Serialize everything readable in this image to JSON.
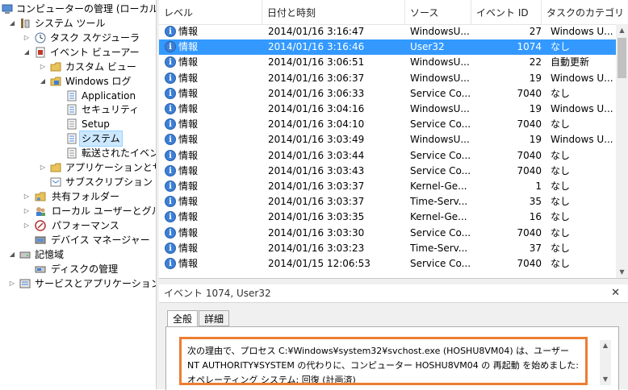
{
  "tree": {
    "root": "コンピューターの管理 (ローカル)",
    "system_tools": "システム ツール",
    "task_scheduler": "タスク スケジューラ",
    "event_viewer": "イベント ビューアー",
    "custom_views": "カスタム ビュー",
    "windows_logs": "Windows ログ",
    "application": "Application",
    "security": "セキュリティ",
    "setup": "Setup",
    "system": "システム",
    "forwarded": "転送されたイベント",
    "apps_services": "アプリケーションとサービ",
    "subscriptions": "サブスクリプション",
    "shared_folders": "共有フォルダー",
    "local_users": "ローカル ユーザーとグループ",
    "performance": "パフォーマンス",
    "device_manager": "デバイス マネージャー",
    "storage": "記憶域",
    "disk_mgmt": "ディスクの管理",
    "services_apps": "サービスとアプリケーション"
  },
  "list": {
    "columns": [
      "レベル",
      "日付と時刻",
      "ソース",
      "イベント ID",
      "タスクのカテゴリ"
    ],
    "rows": [
      {
        "level": "情報",
        "date": "2014/01/16 3:16:47",
        "source": "WindowsU...",
        "id": "27",
        "cat": "Windows U..."
      },
      {
        "level": "情報",
        "date": "2014/01/16 3:16:46",
        "source": "User32",
        "id": "1074",
        "cat": "なし"
      },
      {
        "level": "情報",
        "date": "2014/01/16 3:06:51",
        "source": "WindowsU...",
        "id": "22",
        "cat": "自動更新"
      },
      {
        "level": "情報",
        "date": "2014/01/16 3:06:37",
        "source": "WindowsU...",
        "id": "19",
        "cat": "Windows U..."
      },
      {
        "level": "情報",
        "date": "2014/01/16 3:06:33",
        "source": "Service Co...",
        "id": "7040",
        "cat": "なし"
      },
      {
        "level": "情報",
        "date": "2014/01/16 3:04:16",
        "source": "WindowsU...",
        "id": "19",
        "cat": "Windows U..."
      },
      {
        "level": "情報",
        "date": "2014/01/16 3:04:10",
        "source": "Service Co...",
        "id": "7040",
        "cat": "なし"
      },
      {
        "level": "情報",
        "date": "2014/01/16 3:03:49",
        "source": "WindowsU...",
        "id": "19",
        "cat": "Windows U..."
      },
      {
        "level": "情報",
        "date": "2014/01/16 3:03:44",
        "source": "Service Co...",
        "id": "7040",
        "cat": "なし"
      },
      {
        "level": "情報",
        "date": "2014/01/16 3:03:43",
        "source": "Service Co...",
        "id": "7040",
        "cat": "なし"
      },
      {
        "level": "情報",
        "date": "2014/01/16 3:03:37",
        "source": "Kernel-Ge...",
        "id": "1",
        "cat": "なし"
      },
      {
        "level": "情報",
        "date": "2014/01/16 3:03:37",
        "source": "Time-Serv...",
        "id": "35",
        "cat": "なし"
      },
      {
        "level": "情報",
        "date": "2014/01/16 3:03:35",
        "source": "Kernel-Ge...",
        "id": "16",
        "cat": "なし"
      },
      {
        "level": "情報",
        "date": "2014/01/16 3:03:30",
        "source": "Service Co...",
        "id": "7040",
        "cat": "なし"
      },
      {
        "level": "情報",
        "date": "2014/01/16 3:03:23",
        "source": "Time-Serv...",
        "id": "37",
        "cat": "なし"
      },
      {
        "level": "情報",
        "date": "2014/01/15 12:06:53",
        "source": "Service Co...",
        "id": "7040",
        "cat": "なし"
      }
    ],
    "selected_index": 1
  },
  "details": {
    "title": "イベント 1074, User32",
    "close": "✕",
    "tab_general": "全般",
    "tab_detail": "詳細",
    "description": "次の理由で、プロセス C:¥Windows¥system32¥svchost.exe (HOSHU8VM04) は、ユーザー NT AUTHORITY¥SYSTEM の代わりに、コンピューター HOSHU8VM04 の 再起動 を始めました: オペレーティング システム: 回復 (計画済)"
  },
  "colors": {
    "selection": "#3399ff",
    "highlight_border": "#ed7d31",
    "info_icon": "#3c7fd6"
  }
}
